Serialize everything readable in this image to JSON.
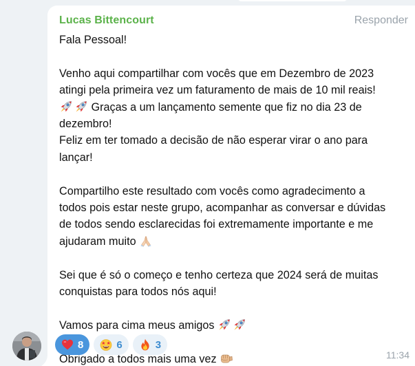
{
  "message": {
    "sender": "Lucas Bittencourt",
    "reply_label": "Responder",
    "time": "11:34",
    "lines": {
      "l1": "Fala Pessoal!",
      "l2": "Venho aqui compartilhar com vocês que em Dezembro de 2023",
      "l3": "atingi pela primeira vez um faturamento de mais de 10 mil reais!",
      "l4": "Graças a um lançamento semente que fiz no dia 23 de",
      "l5": "dezembro!",
      "l6": "Feliz em ter tomado a decisão de não esperar virar o ano para",
      "l7": "lançar!",
      "l8": "Compartilho este resultado com vocês como agradecimento a",
      "l9": "todos pois estar neste grupo, acompanhar as conversar e dúvidas",
      "l10": "de todos sendo esclarecidas foi extremamente importante e me",
      "l11": "ajudaram muito",
      "l12": "Sei que é só o começo e tenho certeza que 2024 será de muitas",
      "l13": "conquistas para todos nós aqui!",
      "l14": "Vamos para cima meus amigos",
      "l15": "Obrigado a todos mais uma vez"
    },
    "emoji_icons": [
      "rocket-icon",
      "praying-hands-icon",
      "fist-bump-icon"
    ]
  },
  "reactions": [
    {
      "icon": "red-heart-icon",
      "count": "8",
      "active": true
    },
    {
      "icon": "star-struck-face-icon",
      "count": "6",
      "active": false
    },
    {
      "icon": "fire-icon",
      "count": "3",
      "active": false
    }
  ],
  "colors": {
    "sender": "#5bb24a",
    "muted": "#9aa3ab",
    "reaction_active_bg": "#4a96dd",
    "reaction_bg": "#e9f1f8",
    "reaction_text": "#3d8cd0",
    "chat_bg": "#eef2f5"
  }
}
